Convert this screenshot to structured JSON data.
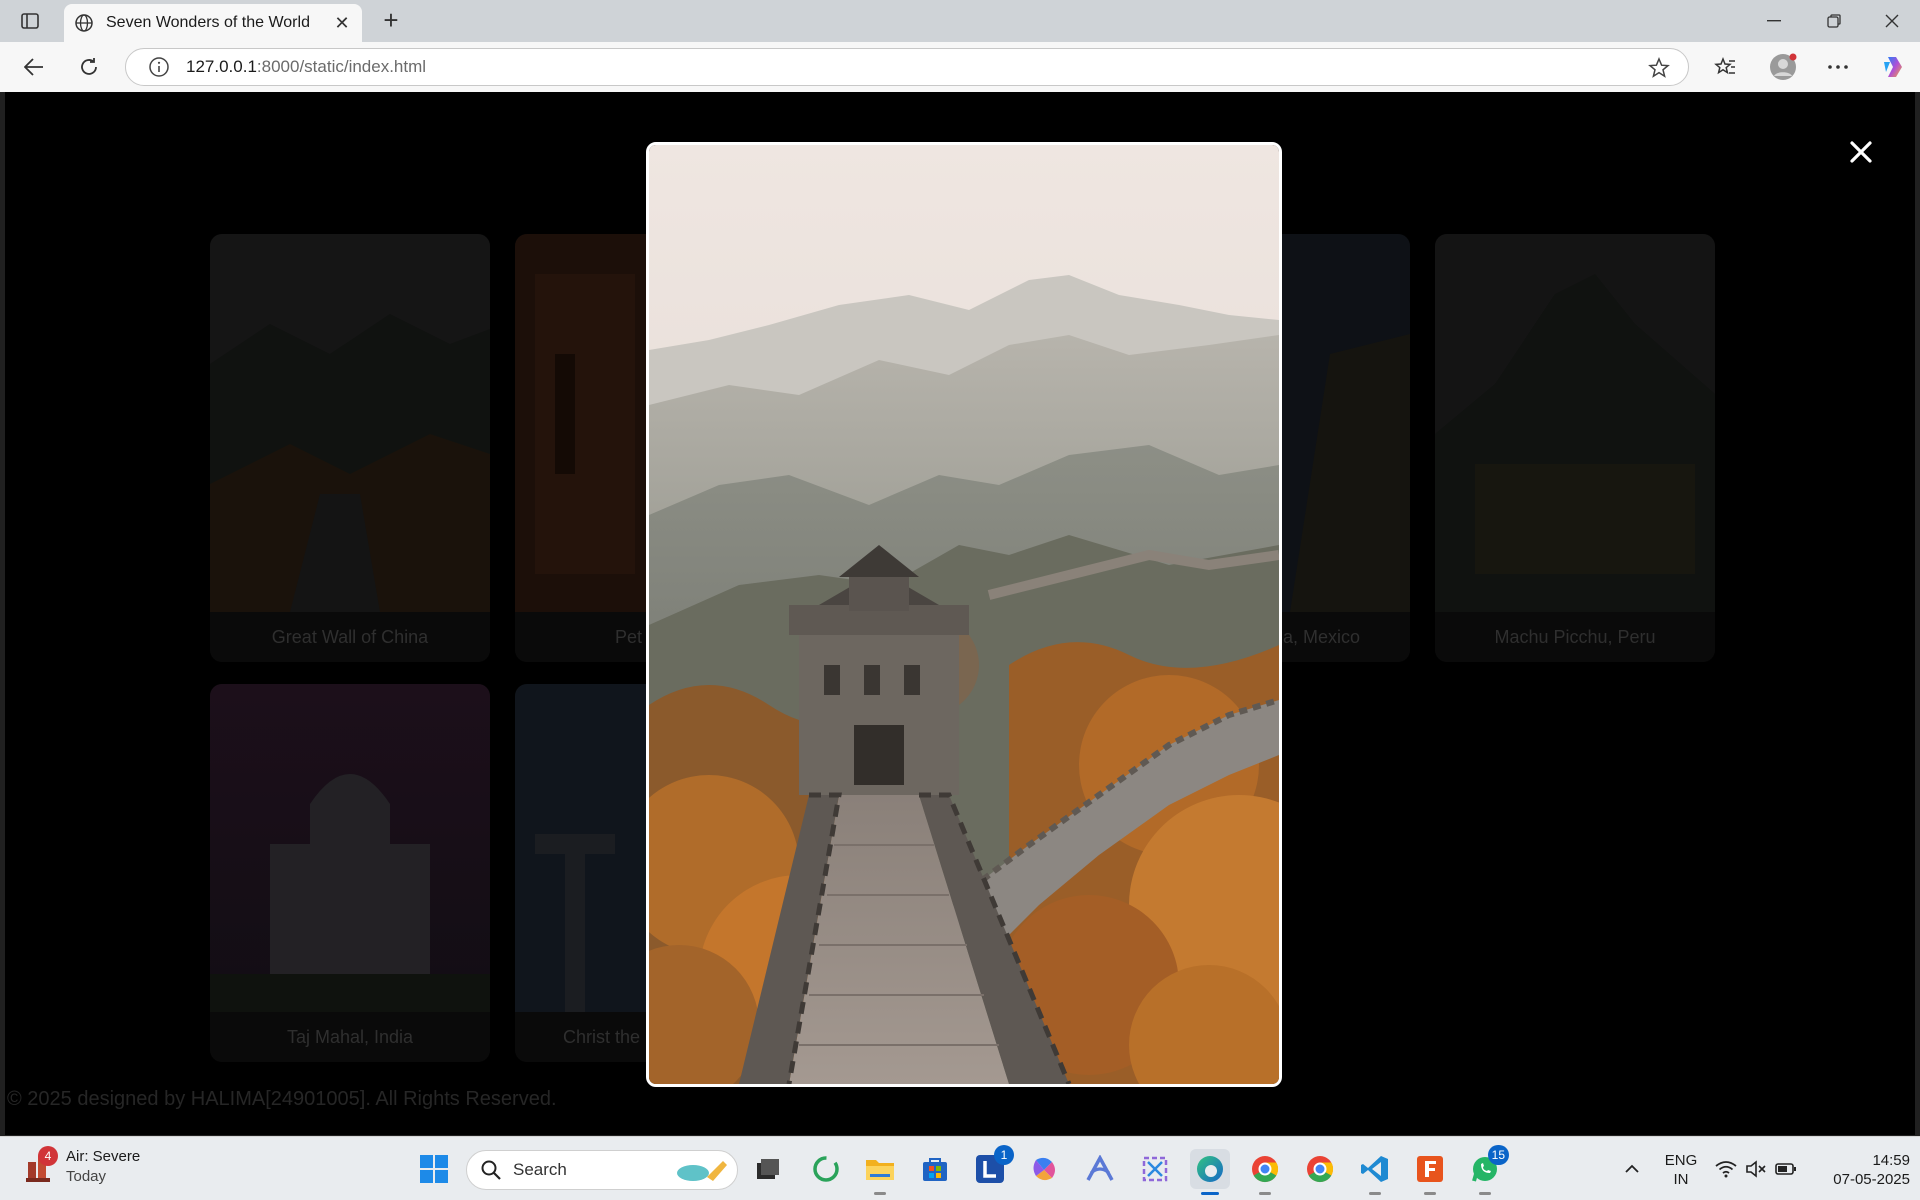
{
  "browser": {
    "tab_title": "Seven Wonders of the World",
    "url_host": "127.0.0.1",
    "url_path": ":8000/static/index.html"
  },
  "page": {
    "cards": [
      {
        "caption": "Great Wall of China"
      },
      {
        "caption": "Pet"
      },
      {
        "caption": "za, Mexico"
      },
      {
        "caption": "Machu Picchu, Peru"
      },
      {
        "caption": "Taj Mahal, India"
      },
      {
        "caption": "Christ the"
      }
    ],
    "footer": "© 2025 designed by HALIMA[24901005]. All Rights Reserved.",
    "close_symbol": "✕"
  },
  "taskbar": {
    "weather_title": "Air: Severe",
    "weather_sub": "Today",
    "weather_badge": "4",
    "search_label": "Search",
    "lang_top": "ENG",
    "lang_bottom": "IN",
    "time": "14:59",
    "date": "07-05-2025",
    "l_badge": "1",
    "whatsapp_badge": "15"
  },
  "colors": {
    "accent": "#0a64c8",
    "modal_border": "#ffffff",
    "page_background": "#000000"
  }
}
